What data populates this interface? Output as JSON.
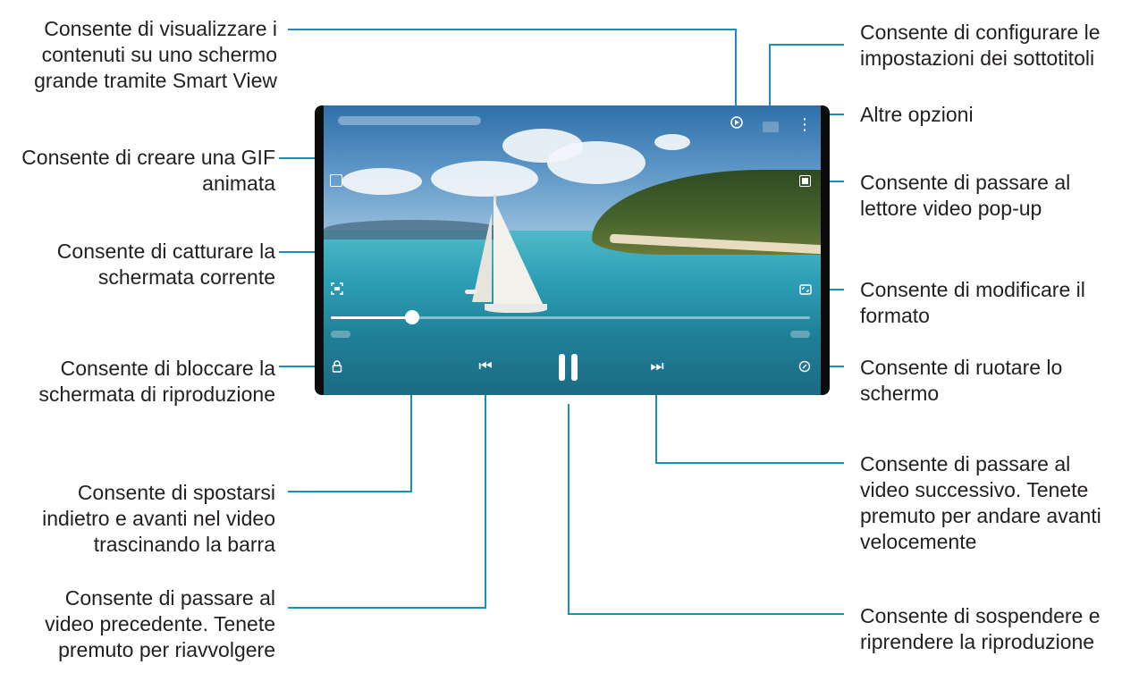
{
  "callouts": {
    "smart_view": [
      "Consente di visualizzare i",
      "contenuti su uno schermo",
      "grande tramite Smart View"
    ],
    "gif": [
      "Consente di creare una GIF",
      "animata"
    ],
    "capture": [
      "Consente di catturare la",
      "schermata corrente"
    ],
    "lock": [
      "Consente di bloccare la",
      "schermata di riproduzione"
    ],
    "seek": [
      "Consente di spostarsi",
      "indietro e avanti nel video",
      "trascinando la barra"
    ],
    "previous": [
      "Consente di passare al",
      "video precedente. Tenete",
      "premuto per riavvolgere"
    ],
    "subtitles": [
      "Consente di configurare le",
      "impostazioni dei sottotitoli"
    ],
    "more": [
      "Altre opzioni"
    ],
    "popup": [
      "Consente di passare al",
      "lettore video pop-up"
    ],
    "ratio": [
      "Consente di modificare il",
      "formato"
    ],
    "rotate": [
      "Consente di ruotare lo",
      "schermo"
    ],
    "next": [
      "Consente di passare al",
      "video successivo. Tenete",
      "premuto per andare avanti",
      "velocemente"
    ],
    "pause": [
      "Consente di sospendere e",
      "riprendere la riproduzione"
    ]
  },
  "player": {
    "seek_progress": 0.17,
    "icons": {
      "gif": "gif-icon",
      "capture": "capture-icon",
      "lock": "lock-icon",
      "smart_view": "smart-view-icon",
      "subtitles": "subtitles-icon",
      "more": "more-options-icon",
      "popup": "popup-player-icon",
      "ratio": "ratio-icon",
      "rotate": "rotate-icon",
      "previous": "previous-icon",
      "pause": "pause-icon",
      "next": "next-icon"
    },
    "glyphs": {
      "more": "⋮",
      "previous": "⏮",
      "next": "⏭"
    }
  },
  "colors": {
    "leader": "#1a8fb8",
    "text": "#231f20"
  }
}
